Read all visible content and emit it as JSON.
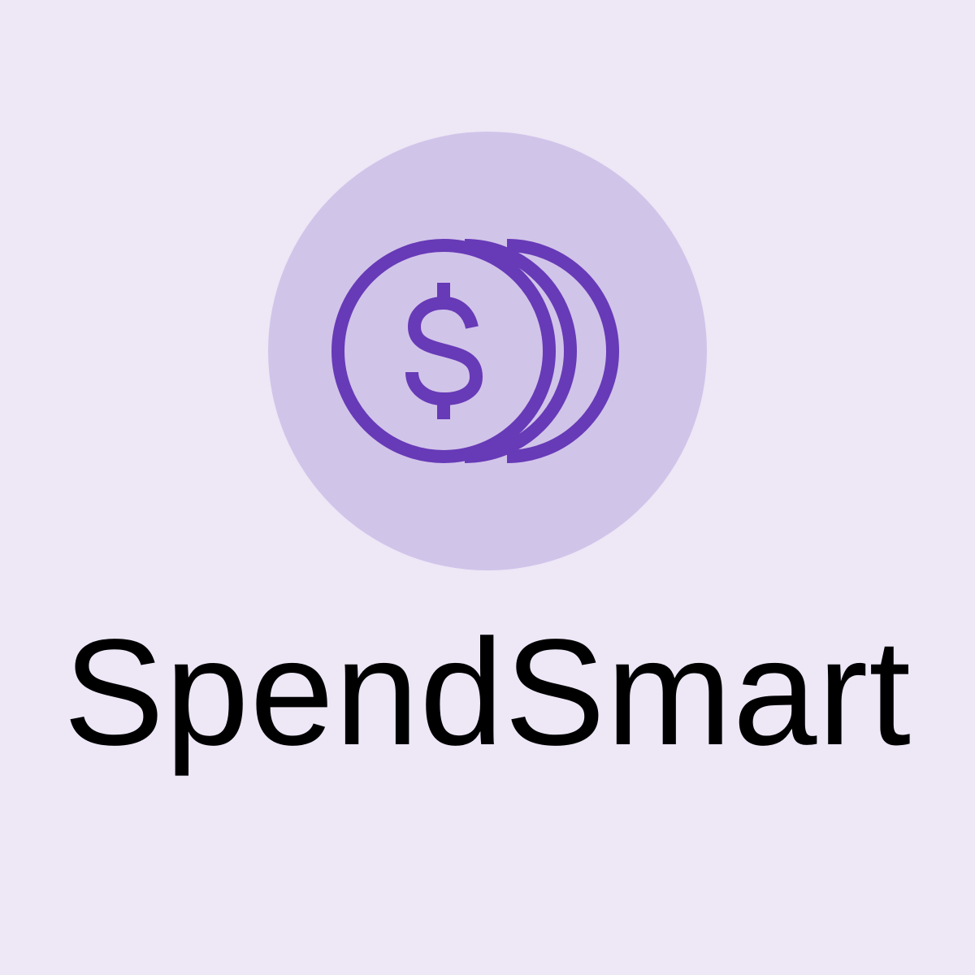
{
  "app": {
    "name": "SpendSmart",
    "icon": "coins-dollar-icon"
  },
  "colors": {
    "background": "#ede7f6",
    "badge": "#d1c4e9",
    "icon_stroke": "#673ab7",
    "text": "#000000"
  }
}
